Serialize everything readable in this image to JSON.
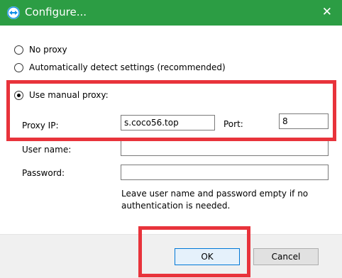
{
  "window": {
    "title": "Configure...",
    "icon": "teamviewer-icon",
    "close_glyph": "✕",
    "titlebar_color": "#2c9d44"
  },
  "proxy_options": {
    "no_proxy": "No proxy",
    "auto_detect": "Automatically detect settings (recommended)",
    "manual": "Use manual proxy:",
    "selected": "manual"
  },
  "manual_proxy": {
    "ip_label": "Proxy IP:",
    "ip_value": "s.coco56.top",
    "port_label": "Port:",
    "port_value": "8",
    "username_label": "User name:",
    "username_value": "",
    "password_label": "Password:",
    "password_value": ""
  },
  "note": "Leave user name and password empty if no authentication is needed.",
  "buttons": {
    "ok": "OK",
    "cancel": "Cancel"
  },
  "highlight_color": "#e8333b"
}
